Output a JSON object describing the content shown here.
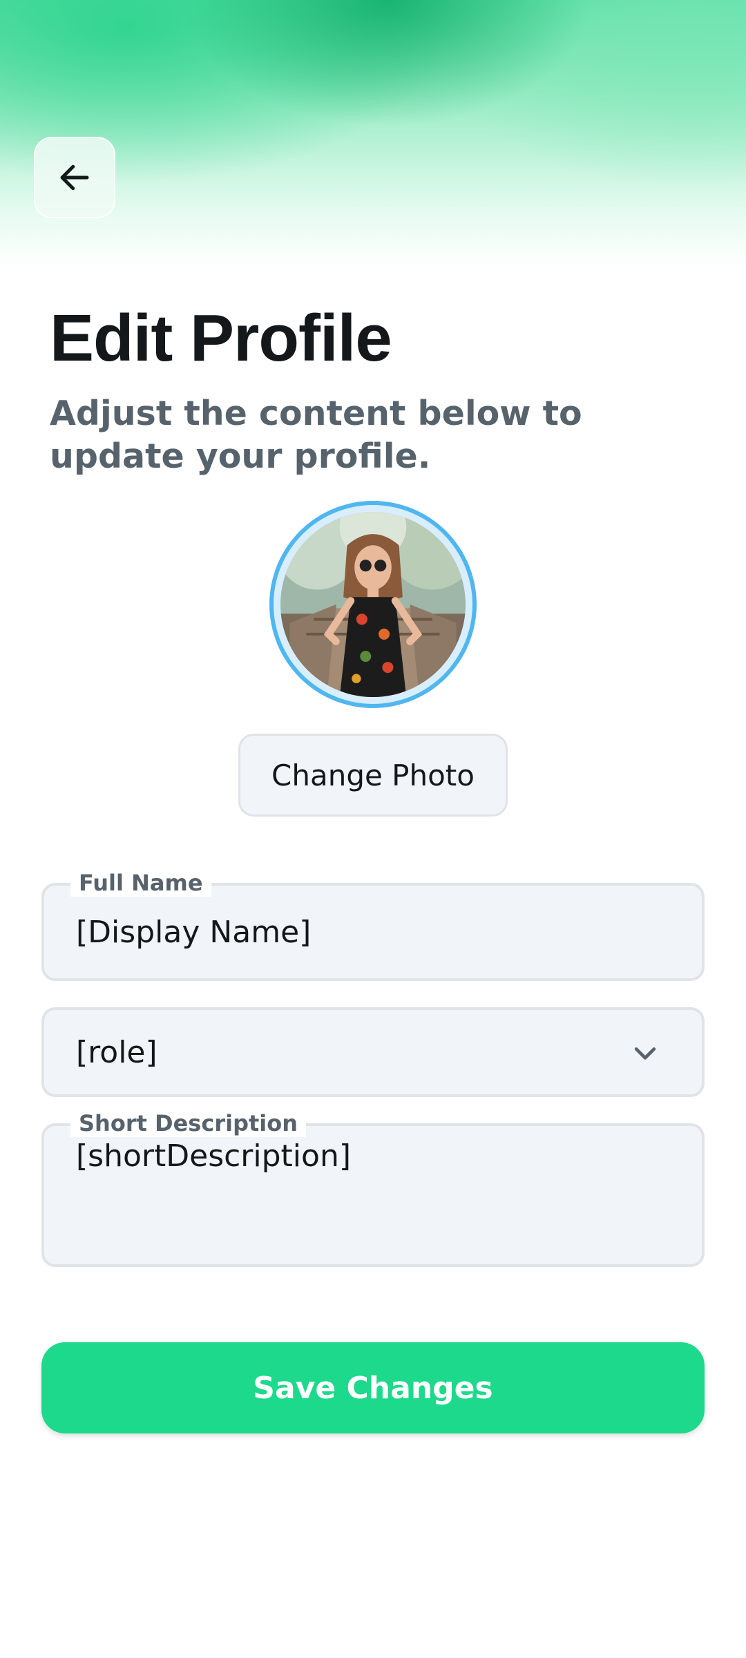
{
  "header": {
    "back_icon": "arrow-left-icon",
    "title": "Edit Profile",
    "subtitle": "Adjust the content below to update your profile."
  },
  "profile_photo": {
    "change_photo_label": "Change Photo"
  },
  "form": {
    "full_name": {
      "label": "Full Name",
      "value": "[Display Name]"
    },
    "role": {
      "value": "[role]",
      "icon": "chevron-down-icon"
    },
    "short_description": {
      "label": "Short Description",
      "value": "[shortDescription]"
    },
    "save_label": "Save Changes"
  },
  "colors": {
    "accent": "#1cd98b",
    "avatar_ring": "#4fb6f0",
    "title_text": "#14181b",
    "secondary_text": "#57636c",
    "field_background": "#f1f4f8"
  }
}
